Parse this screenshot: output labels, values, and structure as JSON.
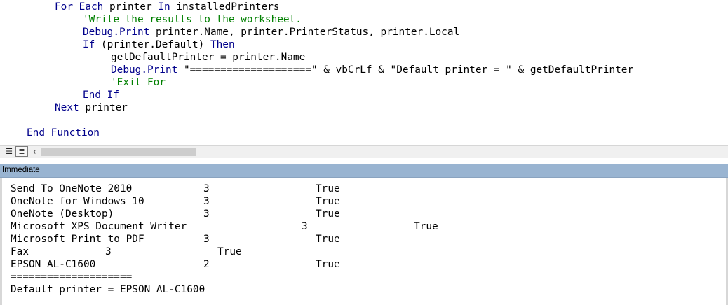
{
  "code": {
    "lines": [
      {
        "indent": 1,
        "parts": [
          {
            "t": "For Each",
            "c": "kw"
          },
          {
            "t": " printer ",
            "c": ""
          },
          {
            "t": "In",
            "c": "kw"
          },
          {
            "t": " installedPrinters",
            "c": ""
          }
        ]
      },
      {
        "indent": 2,
        "parts": [
          {
            "t": "'Write the results to the worksheet.",
            "c": "cm"
          }
        ]
      },
      {
        "indent": 2,
        "parts": [
          {
            "t": "Debug.Print",
            "c": "kw"
          },
          {
            "t": " printer.Name, printer.PrinterStatus, printer.Local",
            "c": ""
          }
        ]
      },
      {
        "indent": 2,
        "parts": [
          {
            "t": "If",
            "c": "kw"
          },
          {
            "t": " (printer.Default) ",
            "c": ""
          },
          {
            "t": "Then",
            "c": "kw"
          }
        ]
      },
      {
        "indent": 3,
        "parts": [
          {
            "t": "getDefaultPrinter = printer.Name",
            "c": ""
          }
        ]
      },
      {
        "indent": 3,
        "parts": [
          {
            "t": "Debug.Print",
            "c": "kw"
          },
          {
            "t": " \"====================\" & vbCrLf & \"Default printer = \" & getDefaultPrinter",
            "c": ""
          }
        ]
      },
      {
        "indent": 3,
        "parts": [
          {
            "t": "'Exit For",
            "c": "cm"
          }
        ]
      },
      {
        "indent": 2,
        "parts": [
          {
            "t": "End If",
            "c": "kw"
          }
        ]
      },
      {
        "indent": 1,
        "parts": [
          {
            "t": "Next",
            "c": "kw"
          },
          {
            "t": " printer",
            "c": ""
          }
        ]
      },
      {
        "indent": 0,
        "parts": []
      },
      {
        "indent": 0,
        "parts": [
          {
            "t": "End Function",
            "c": "kw"
          }
        ]
      }
    ]
  },
  "toolbar": {
    "procedure_view_icon": "procedure-view-icon",
    "full_module_view_icon": "full-module-view-icon",
    "scroll_left_glyph": "‹"
  },
  "immediate": {
    "title": "Immediate",
    "rows": [
      {
        "name": "Send To OneNote 2010",
        "status": "3",
        "local": "True"
      },
      {
        "name": "OneNote for Windows 10",
        "status": "3",
        "local": "True"
      },
      {
        "name": "OneNote (Desktop)",
        "status": "3",
        "local": "True"
      },
      {
        "name": "Microsoft XPS Document Writer",
        "status": "3",
        "local": "True"
      },
      {
        "name": "Microsoft Print to PDF",
        "status": "3",
        "local": "True"
      },
      {
        "name": "Fax",
        "status": "3",
        "local": "True"
      },
      {
        "name": "EPSON AL-C1600",
        "status": "2",
        "local": "True"
      }
    ],
    "separator": "====================",
    "default_line": "Default printer = EPSON AL-C1600"
  },
  "colors": {
    "keyword": "#00008b",
    "comment": "#008000",
    "immediate_title_bar": "#99b4d1"
  }
}
